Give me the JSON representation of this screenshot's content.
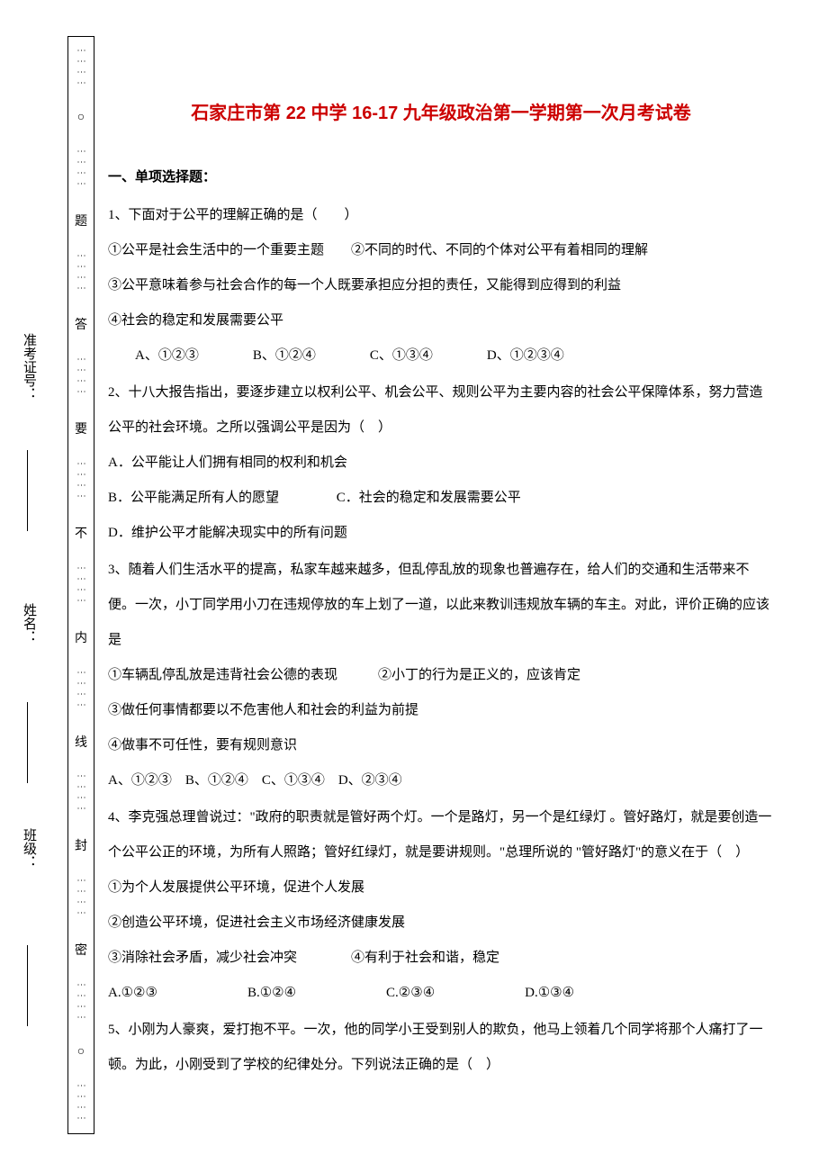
{
  "margin_labels": {
    "class": "班级：",
    "name": "姓名：",
    "exam_number": "准考证号："
  },
  "binding_chars": [
    "密",
    "封",
    "线",
    "内",
    "不",
    "要",
    "答",
    "题"
  ],
  "title": "石家庄市第 22 中学 16-17 九年级政治第一学期第一次月考试卷",
  "section_header": "一、单项选择题：",
  "q1": {
    "stem": "1、下面对于公平的理解正确的是（　　）",
    "s1": "①公平是社会生活中的一个重要主题　　②不同的时代、不同的个体对公平有着相同的理解",
    "s2": "③公平意味着参与社会合作的每一个人既要承担应分担的责任，又能得到应得到的利益",
    "s3": "④社会的稳定和发展需要公平",
    "a": "A、①②③",
    "b": "B、①②④",
    "c": "C、①③④",
    "d": "D、①②③④"
  },
  "q2": {
    "stem": "2、十八大报告指出，要逐步建立以权利公平、机会公平、规则公平为主要内容的社会公平保障体系，努力营造公平的社会环境。之所以强调公平是因为（　）",
    "a": "A．公平能让人们拥有相同的权利和机会",
    "b": "B．公平能满足所有人的愿望",
    "c": "C．社会的稳定和发展需要公平",
    "d": "D．维护公平才能解决现实中的所有问题"
  },
  "q3": {
    "stem": "3、随着人们生活水平的提高，私家车越来越多，但乱停乱放的现象也普遍存在，给人们的交通和生活带来不便。一次，小丁同学用小刀在违规停放的车上划了一道，以此来教训违规放车辆的车主。对此，评价正确的应该是",
    "s1": "①车辆乱停乱放是违背社会公德的表现　　　②小丁的行为是正义的，应该肯定",
    "s2": "③做任何事情都要以不危害他人和社会的利益为前提",
    "s3": "④做事不可任性，要有规则意识",
    "opts": "A、①②③　B、①②④　C、①③④　D、②③④"
  },
  "q4": {
    "stem": "4、李克强总理曾说过：\"政府的职责就是管好两个灯。一个是路灯，另一个是红绿灯 。管好路灯，就是要创造一个公平公正的环境，为所有人照路；管好红绿灯，就是要讲规则。\"总理所说的 \"管好路灯\"的意义在于（　）",
    "s1": "①为个人发展提供公平环境，促进个人发展",
    "s2": "②创造公平环境，促进社会主义市场经济健康发展",
    "s3": "③消除社会矛盾，减少社会冲突　　　　④有利于社会和谐，稳定",
    "a": "A.①②③",
    "b": "B.①②④",
    "c": "C.②③④",
    "d": "D.①③④"
  },
  "q5": {
    "stem": "5、小刚为人豪爽，爱打抱不平。一次，他的同学小王受到别人的欺负，他马上领着几个同学将那个人痛打了一顿。为此，小刚受到了学校的纪律处分。下列说法正确的是（　）"
  }
}
